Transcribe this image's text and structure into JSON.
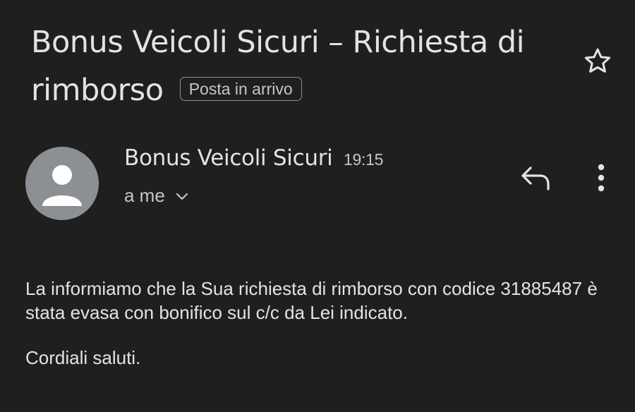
{
  "email": {
    "subject": "Bonus Veicoli Sicuri – Richiesta di rimborso",
    "label": "Posta in arrivo",
    "sender_name": "Bonus Veicoli Sicuri",
    "time": "19:15",
    "recipient": "a me",
    "body": {
      "paragraph_1": "La informiamo che la Sua richiesta di rimborso con codice 31885487 è stata evasa con bonifico sul c/c da Lei indicato.",
      "paragraph_2": "Cordiali saluti."
    }
  },
  "icons": {
    "star": "star-icon",
    "avatar": "person-icon",
    "chevron": "chevron-down-icon",
    "reply": "reply-icon",
    "more": "more-vert-icon"
  },
  "colors": {
    "background": "#1f1f1f",
    "text_primary": "#e3e3e3",
    "text_secondary": "#c4c7c5",
    "avatar_bg": "#8c8f93"
  }
}
